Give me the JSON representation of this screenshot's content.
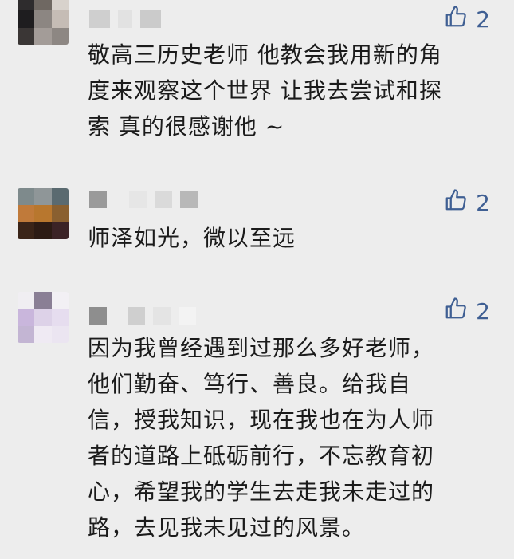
{
  "comments": [
    {
      "likes": "2",
      "text": "敬高三历史老师 他教会我用新的角\n度来观察这个世界 让我去尝试和探\n索 真的很感谢他 ~"
    },
    {
      "likes": "2",
      "text": "师泽如光，微以至远"
    },
    {
      "likes": "2",
      "text": "因为我曾经遇到过那么多好老师，\n他们勤奋、笃行、善良。给我自\n信，授我知识，现在我也在为人师\n者的道路上砥砺前行，不忘教育初\n心，希望我的学生去走我未走过的\n路，去见我未见过的风景。"
    }
  ],
  "colors": {
    "background": "#ededed",
    "like_accent": "#3f5f93",
    "text": "#1b1b1b"
  },
  "icons": {
    "like": "thumbs-up-icon"
  }
}
